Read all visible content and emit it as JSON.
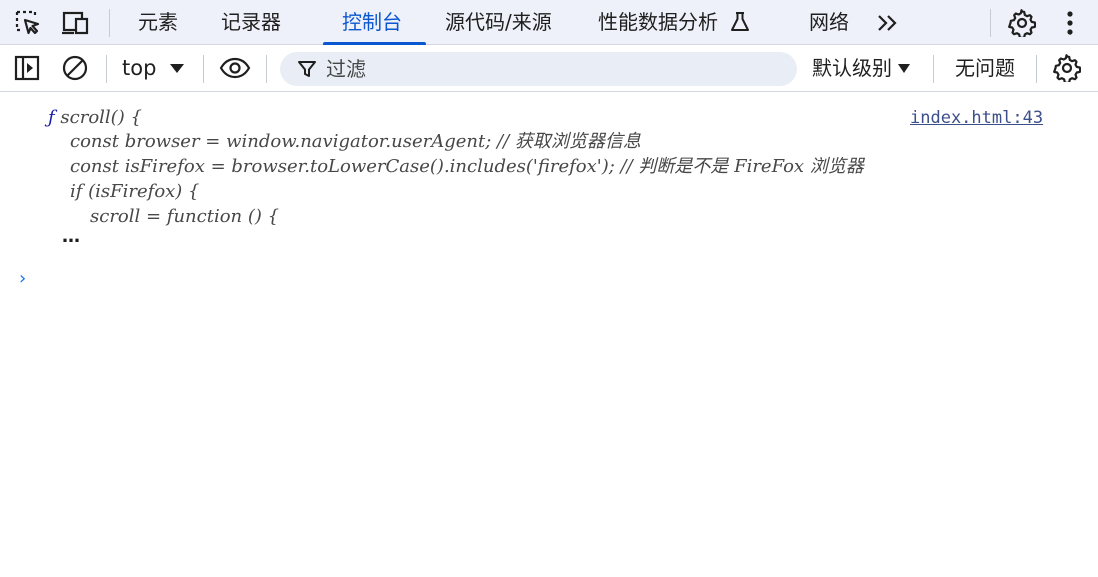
{
  "tabs": [
    {
      "label": "元素",
      "active": false
    },
    {
      "label": "记录器",
      "active": false
    },
    {
      "label": "控制台",
      "active": true
    },
    {
      "label": "源代码/来源",
      "active": false
    },
    {
      "label": "性能数据分析",
      "active": false
    },
    {
      "label": "网络",
      "active": false
    }
  ],
  "toolbar": {
    "context": "top",
    "filter_placeholder": "过滤",
    "level": "默认级别",
    "issues": "无问题"
  },
  "console": {
    "fn_prefix": "ƒ",
    "lines": [
      "scroll() {",
      "const browser = window.navigator.userAgent; // 获取浏览器信息",
      "const isFirefox = browser.toLowerCase().includes('firefox'); // 判断是不是 FireFox 浏览器",
      "if (isFirefox) {",
      "scroll = function () {"
    ],
    "ellipsis": "…",
    "source_link": "index.html:43",
    "prompt": "›"
  },
  "colors": {
    "accent": "#0b57d0",
    "tabbar_bg": "#eef1f9",
    "filter_bg": "#e9eef6"
  }
}
